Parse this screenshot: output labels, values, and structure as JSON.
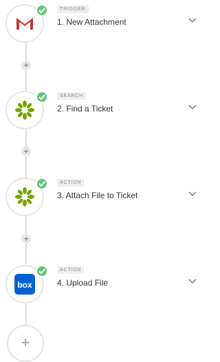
{
  "steps": [
    {
      "tag": "TRIGGER",
      "title": "1. New Attachment",
      "icon": "gmail-icon"
    },
    {
      "tag": "SEARCH",
      "title": "2. Find a Ticket",
      "icon": "zendesk-icon"
    },
    {
      "tag": "ACTION",
      "title": "3. Attach File to Ticket",
      "icon": "zendesk-icon"
    },
    {
      "tag": "ACTION",
      "title": "4. Upload File",
      "icon": "box-icon"
    }
  ],
  "connector_plus": "+",
  "add_step_label": "+",
  "colors": {
    "check": "#62c77b",
    "gmail_red": "#d44638",
    "zendesk_green": "#78a300",
    "box_blue": "#0061d5"
  }
}
